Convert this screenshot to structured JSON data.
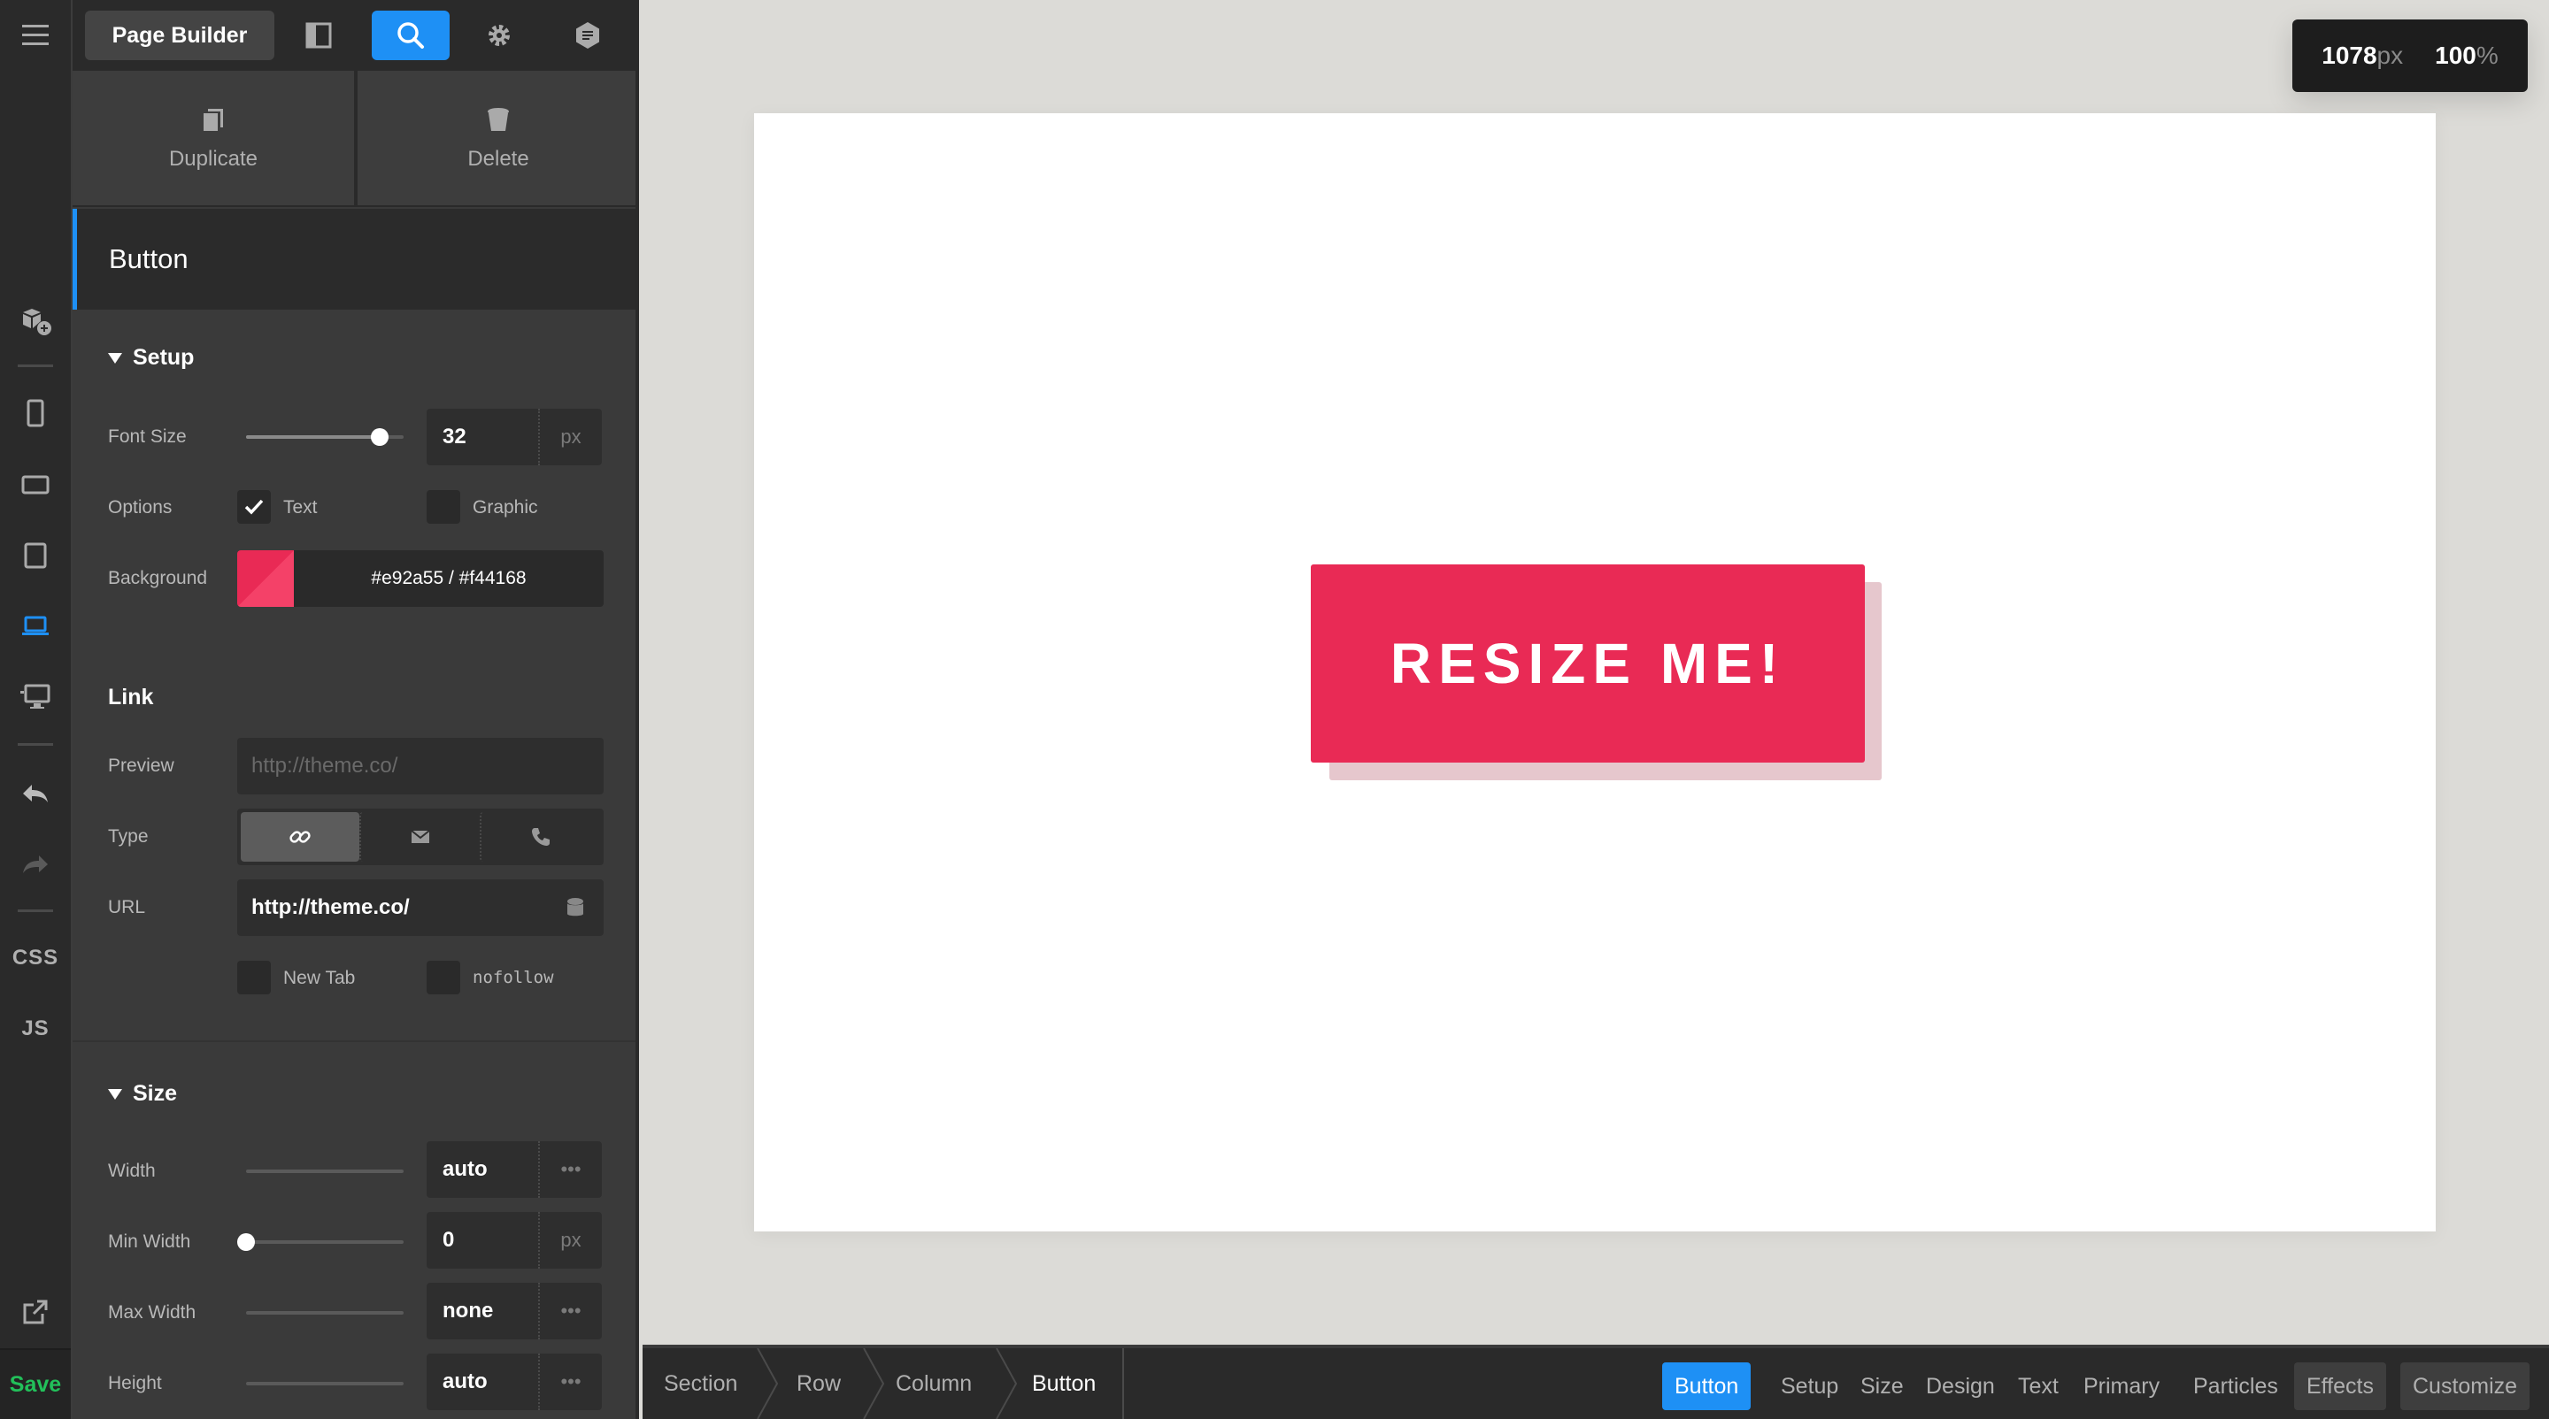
{
  "rail": {
    "css_label": "CSS",
    "js_label": "JS",
    "save_label": "Save"
  },
  "topbar": {
    "title": "Page Builder"
  },
  "actions": {
    "duplicate_label": "Duplicate",
    "delete_label": "Delete"
  },
  "element": {
    "title": "Button"
  },
  "setup": {
    "heading": "Setup",
    "font_size_label": "Font Size",
    "font_size_value": "32",
    "font_size_unit": "px",
    "font_size_slider": 0.85,
    "options_label": "Options",
    "option_text_label": "Text",
    "option_text_checked": true,
    "option_graphic_label": "Graphic",
    "option_graphic_checked": false,
    "background_label": "Background",
    "background_value": "#e92a55 / #f44168",
    "background_color_primary": "#e92a55",
    "background_color_secondary": "#f44168"
  },
  "link": {
    "heading": "Link",
    "preview_label": "Preview",
    "preview_placeholder": "http://theme.co/",
    "type_label": "Type",
    "url_label": "URL",
    "url_value": "http://theme.co/",
    "new_tab_label": "New Tab",
    "nofollow_label": "nofollow"
  },
  "size": {
    "heading": "Size",
    "width_label": "Width",
    "width_value": "auto",
    "min_width_label": "Min Width",
    "min_width_value": "0",
    "min_width_unit": "px",
    "max_width_label": "Max Width",
    "max_width_value": "none",
    "height_label": "Height",
    "height_value": "auto",
    "more_glyph": "•••"
  },
  "canvas": {
    "viewport_width": "1078",
    "viewport_width_unit": "px",
    "zoom": "100",
    "zoom_unit": "%",
    "button_text": "RESIZE ME!",
    "button_color": "#e92a55"
  },
  "breadcrumbs": [
    "Section",
    "Row",
    "Column",
    "Button"
  ],
  "tabs": [
    "Button",
    "Setup",
    "Size",
    "Design",
    "Text",
    "Primary",
    "Particles",
    "Effects",
    "Customize"
  ]
}
